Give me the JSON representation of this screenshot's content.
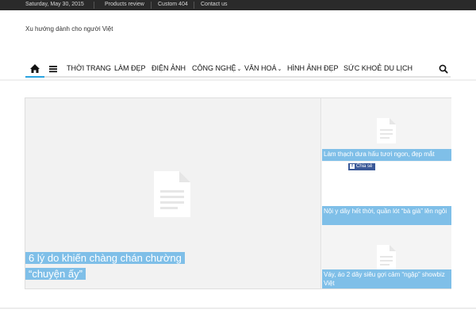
{
  "topbar": {
    "date": "Saturday, May 30, 2015",
    "links": [
      "Products review",
      "Custom 404",
      "Contact us"
    ]
  },
  "site": {
    "tagline": "Xu hướng dành cho người Việt"
  },
  "nav": {
    "items": [
      {
        "label": "THỜI TRANG"
      },
      {
        "label": "LÀM ĐẸP"
      },
      {
        "label": "ĐIỆN ẢNH"
      },
      {
        "label": "CÔNG NGHỆ"
      },
      {
        "label": "VĂN HOÁ"
      },
      {
        "label": "HÌNH ẢNH ĐẸP"
      },
      {
        "label": "SỨC KHOẺ"
      },
      {
        "label": "DU LỊCH"
      }
    ]
  },
  "featured": {
    "main_title": "6 lý do khiến chàng chán chường “chuyện ấy”",
    "side": [
      {
        "title": "Làm thạch dưa hấu tươi ngon, đẹp mắt"
      },
      {
        "title": "Nội y dây hết thời, quần lót “bà già” lên ngôi"
      },
      {
        "title": "Váy, áo 2 dây siêu gợi cảm “ngập” showbiz Việt"
      }
    ],
    "share_label": "Chia sẻ"
  },
  "colors": {
    "accent": "#29a3e0",
    "caption_bg": "#7fbfe8",
    "topbar_bg": "#2a2a2a",
    "facebook": "#3b5998"
  },
  "icons": [
    "home-icon",
    "menu-icon",
    "search-icon",
    "document-icon",
    "facebook-icon"
  ]
}
